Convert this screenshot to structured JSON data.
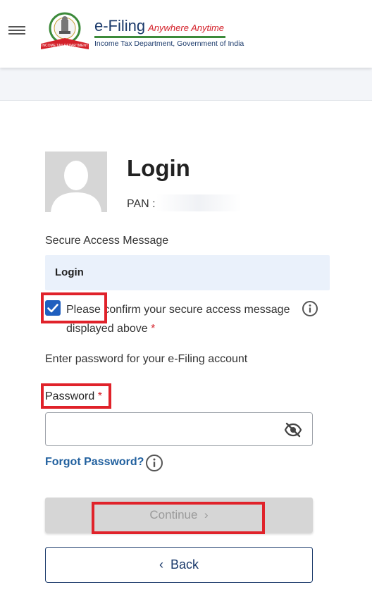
{
  "header": {
    "brand_title": "e-Filing",
    "brand_tagline": "Anywhere Anytime",
    "brand_subtitle": "Income Tax Department, Government of India",
    "logo_text": "INCOME TAX DEPARTMENT"
  },
  "login": {
    "title": "Login",
    "pan_label": "PAN :",
    "secure_access_label": "Secure Access Message",
    "secure_access_value": "Login",
    "confirm_text": "Please confirm your secure access message displayed above",
    "confirm_required": "*",
    "confirm_checked": true,
    "enter_password_text": "Enter password for your e-Filing account",
    "password_label": "Password",
    "password_required": "*",
    "password_value": "",
    "forgot_password": "Forgot Password?",
    "continue_label": "Continue",
    "continue_chevron": "›",
    "back_label": "Back",
    "back_chevron": "‹"
  },
  "icons": {
    "menu": "menu-icon",
    "info": "info-icon",
    "eye": "eye-off-icon",
    "check": "checkmark-icon",
    "avatar": "user-avatar"
  },
  "colors": {
    "primary": "#1b3a6b",
    "link": "#22619f",
    "checkbox": "#1f5fbf",
    "required": "#d4212a",
    "highlight": "#e0222a",
    "info_box": "#eaf1fb",
    "disabled_button": "#d6d6d6"
  }
}
